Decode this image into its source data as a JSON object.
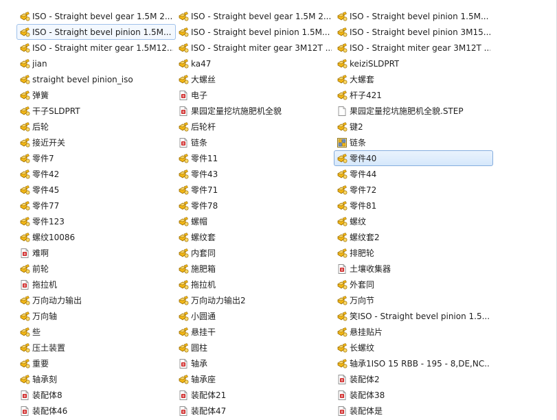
{
  "colors": {
    "part_icon": "#f2b616",
    "drawing_icon": "#cc1e1e",
    "selection": "#d6e8fb",
    "selection_border": "#84acdd"
  },
  "columns": [
    [
      {
        "label": "ISO - Straight bevel gear 1.5M 2...",
        "icon": "part"
      },
      {
        "label": "ISO - Straight bevel pinion 1.5M...",
        "icon": "part",
        "state": "focused"
      },
      {
        "label": "ISO - Straight miter gear 1.5M12...",
        "icon": "part"
      },
      {
        "label": "jian",
        "icon": "part"
      },
      {
        "label": "straight bevel pinion_iso",
        "icon": "part"
      },
      {
        "label": "弹簧",
        "icon": "part"
      },
      {
        "label": "干子SLDPRT",
        "icon": "part"
      },
      {
        "label": "后轮",
        "icon": "part"
      },
      {
        "label": "接近开关",
        "icon": "part"
      },
      {
        "label": "零件7",
        "icon": "part"
      },
      {
        "label": "零件42",
        "icon": "part"
      },
      {
        "label": "零件45",
        "icon": "part"
      },
      {
        "label": "零件77",
        "icon": "part"
      },
      {
        "label": "零件123",
        "icon": "part"
      },
      {
        "label": "螺纹10086",
        "icon": "part"
      },
      {
        "label": "难啊",
        "icon": "drawing"
      },
      {
        "label": "前轮",
        "icon": "part"
      },
      {
        "label": "拖拉机",
        "icon": "drawing"
      },
      {
        "label": "万向动力输出",
        "icon": "part"
      },
      {
        "label": "万向轴",
        "icon": "part"
      },
      {
        "label": "些",
        "icon": "part"
      },
      {
        "label": "压土装置",
        "icon": "part"
      },
      {
        "label": "重要",
        "icon": "part"
      },
      {
        "label": "轴承刻",
        "icon": "part"
      },
      {
        "label": "装配体8",
        "icon": "drawing"
      },
      {
        "label": "装配体46",
        "icon": "drawing"
      }
    ],
    [
      {
        "label": "ISO - Straight bevel gear 1.5M 2...",
        "icon": "part"
      },
      {
        "label": "ISO - Straight bevel pinion 1.5M...",
        "icon": "part"
      },
      {
        "label": "ISO - Straight miter gear 3M12T ...",
        "icon": "part"
      },
      {
        "label": "ka47",
        "icon": "part"
      },
      {
        "label": "大螺丝",
        "icon": "part"
      },
      {
        "label": "电子",
        "icon": "drawing"
      },
      {
        "label": "果园定量挖坑施肥机全貌",
        "icon": "drawing"
      },
      {
        "label": "后轮杆",
        "icon": "part"
      },
      {
        "label": "链条",
        "icon": "drawing"
      },
      {
        "label": "零件11",
        "icon": "part"
      },
      {
        "label": "零件43",
        "icon": "part"
      },
      {
        "label": "零件71",
        "icon": "part"
      },
      {
        "label": "零件78",
        "icon": "part"
      },
      {
        "label": "螺帽",
        "icon": "part"
      },
      {
        "label": "螺纹套",
        "icon": "part"
      },
      {
        "label": "内套同",
        "icon": "part"
      },
      {
        "label": "施肥箱",
        "icon": "part"
      },
      {
        "label": "拖拉机",
        "icon": "part"
      },
      {
        "label": "万向动力输出2",
        "icon": "part"
      },
      {
        "label": "小圆通",
        "icon": "part"
      },
      {
        "label": "悬挂干",
        "icon": "part"
      },
      {
        "label": "圆柱",
        "icon": "part"
      },
      {
        "label": "轴承",
        "icon": "drawing"
      },
      {
        "label": "轴承座",
        "icon": "part"
      },
      {
        "label": "装配体21",
        "icon": "drawing"
      },
      {
        "label": "装配体47",
        "icon": "drawing"
      }
    ],
    [
      {
        "label": "ISO - Straight bevel pinion 1.5M...",
        "icon": "part"
      },
      {
        "label": "ISO - Straight bevel pinion 3M15...",
        "icon": "part"
      },
      {
        "label": "ISO - Straight miter gear 3M12T ...",
        "icon": "part"
      },
      {
        "label": "keiziSLDPRT",
        "icon": "part"
      },
      {
        "label": "大螺套",
        "icon": "part"
      },
      {
        "label": "杆子421",
        "icon": "part"
      },
      {
        "label": "果园定量挖坑施肥机全貌.STEP",
        "icon": "blank"
      },
      {
        "label": "键2",
        "icon": "part"
      },
      {
        "label": "链条",
        "icon": "assembly"
      },
      {
        "label": "零件40",
        "icon": "part",
        "state": "selected"
      },
      {
        "label": "零件44",
        "icon": "part"
      },
      {
        "label": "零件72",
        "icon": "part"
      },
      {
        "label": "零件81",
        "icon": "part"
      },
      {
        "label": "螺纹",
        "icon": "part"
      },
      {
        "label": "螺纹套2",
        "icon": "part"
      },
      {
        "label": "排肥轮",
        "icon": "part"
      },
      {
        "label": "土壤收集器",
        "icon": "drawing"
      },
      {
        "label": "外套同",
        "icon": "part"
      },
      {
        "label": "万向节",
        "icon": "part"
      },
      {
        "label": "笑ISO - Straight bevel pinion 1.5...",
        "icon": "part"
      },
      {
        "label": "悬挂贴片",
        "icon": "part"
      },
      {
        "label": "长螺纹",
        "icon": "part"
      },
      {
        "label": "轴承1ISO 15 RBB - 195 - 8,DE,NC...",
        "icon": "part"
      },
      {
        "label": "装配体2",
        "icon": "drawing"
      },
      {
        "label": "装配体38",
        "icon": "drawing"
      },
      {
        "label": "装配体是",
        "icon": "drawing"
      }
    ]
  ]
}
